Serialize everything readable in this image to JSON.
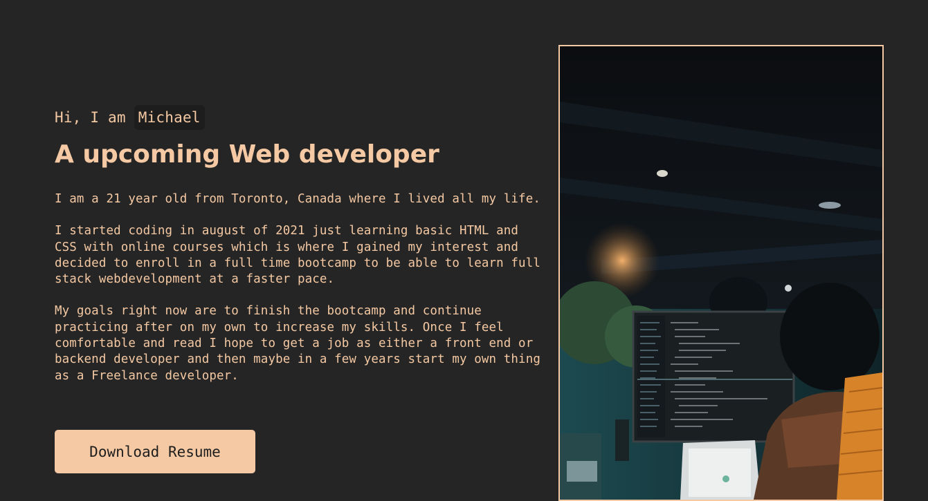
{
  "hero": {
    "greeting": "Hi, I am",
    "name": "Michael",
    "headline": "A upcoming Web developer",
    "bio": [
      "I am a 21 year old from Toronto, Canada where I lived all my life.",
      "I started coding in august of 2021 just learning basic HTML and CSS with online courses which is where I gained my interest and decided to enroll in a full time bootcamp to be able to learn full stack webdevelopment at a faster pace.",
      "My goals right now are to finish the bootcamp and continue practicing after on my own to increase my skills. Once I feel comfortable and read I hope to get a job as either a front end or backend developer and then maybe in a few years start my own thing as a Freelance developer."
    ],
    "resume_button": "Download Resume"
  },
  "photo": {
    "icon": "developer-at-monitor-photo"
  },
  "colors": {
    "background": "#252525",
    "accent": "#f5c9a3",
    "button_text": "#1e1e1e"
  }
}
